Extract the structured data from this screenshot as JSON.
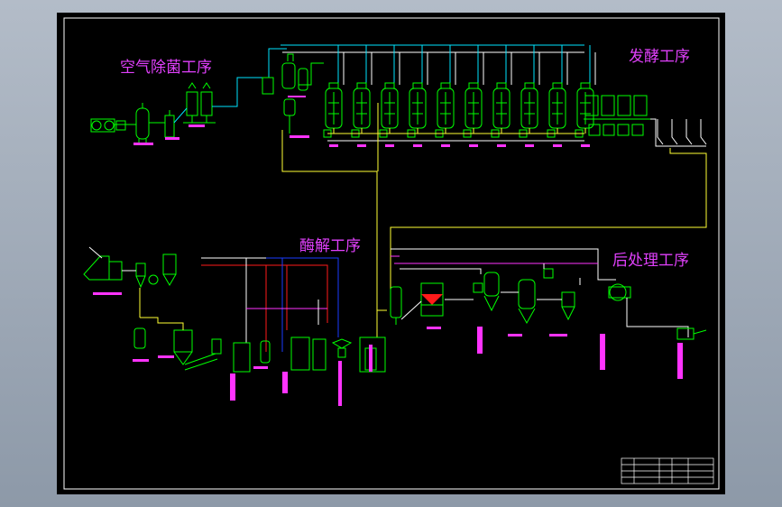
{
  "sections": {
    "air": "空气除菌工序",
    "fermentation": "发酵工序",
    "enzymolysis": "酶解工序",
    "post": "后处理工序"
  },
  "colors": {
    "background": "#000000",
    "frame": "#ffffff",
    "equipment": "#00ff00",
    "air_line": "#00e5ff",
    "steam_line": "#ff1a1a",
    "water_line": "#1a3cff",
    "material_line": "#ffff33",
    "label": "#ff33ff",
    "title_text": "#e040fb"
  },
  "icons": [
    "tank-icon",
    "filter-icon",
    "compressor-icon",
    "cyclone-icon",
    "evaporator-icon",
    "pump-icon"
  ]
}
